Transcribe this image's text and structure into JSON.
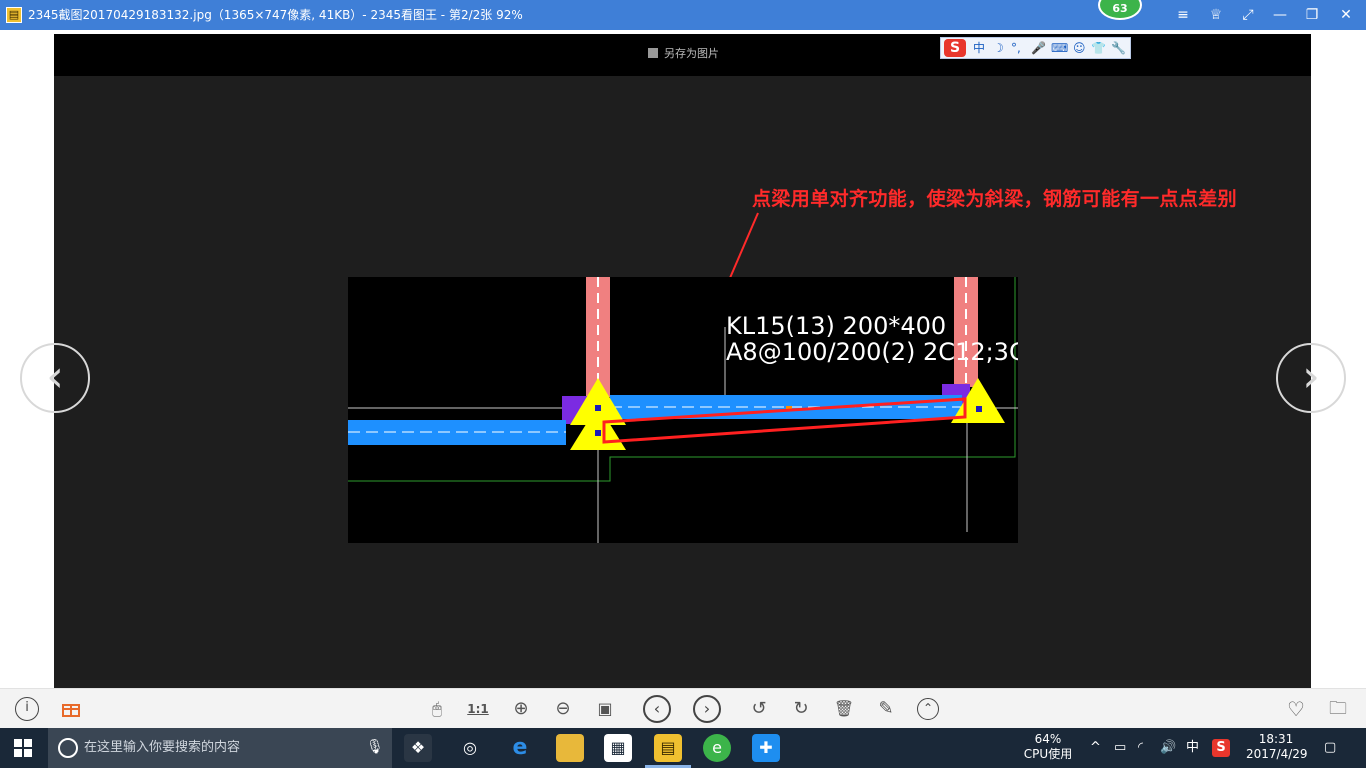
{
  "window": {
    "title": "2345截图20170429183132.jpg（1365×747像素, 41KB）- 2345看图王 - 第2/2张 92%",
    "notification_count": "63",
    "controls": [
      "≡",
      "♕",
      "⤢",
      "—",
      "❐",
      "✕"
    ]
  },
  "viewer": {
    "save_label": "另存为图片",
    "ime_letter": "S",
    "ime_glyphs": [
      "中",
      "☽",
      "°,",
      "🎤",
      "⌨",
      "☺",
      "👕",
      "🔧"
    ],
    "prev_arrow": "‹",
    "next_arrow": "›",
    "annotation": "点梁用单对齐功能，使梁为斜梁，钢筋可能有一点点差别",
    "cad": {
      "label_line1": "KL15(13) 200*400",
      "label_line2": "A8@100/200(2) 2C12;3C"
    }
  },
  "toolbar": {
    "info_icon": "i",
    "tools": [
      "🖱",
      "1:1",
      "⊕",
      "⊖",
      "▣",
      "‹",
      "›",
      "↺",
      "↻",
      "🗑",
      "✎",
      "⌃"
    ],
    "favorite_icon": "♡",
    "folder_icon": "🗀"
  },
  "taskbar": {
    "search_placeholder": "在这里输入你要搜索的内容",
    "cpu_percent": "64%",
    "cpu_label": "CPU使用",
    "ime_mode": "中",
    "time": "18:31",
    "date": "2017/4/29"
  },
  "colors": {
    "title_bar": "#3f7fd7",
    "annotation_red": "#ff2a2a",
    "beam_blue": "#1e90ff",
    "column_pink": "#f08080",
    "support_yellow": "#ffff00",
    "taskbar": "#1a2838"
  }
}
